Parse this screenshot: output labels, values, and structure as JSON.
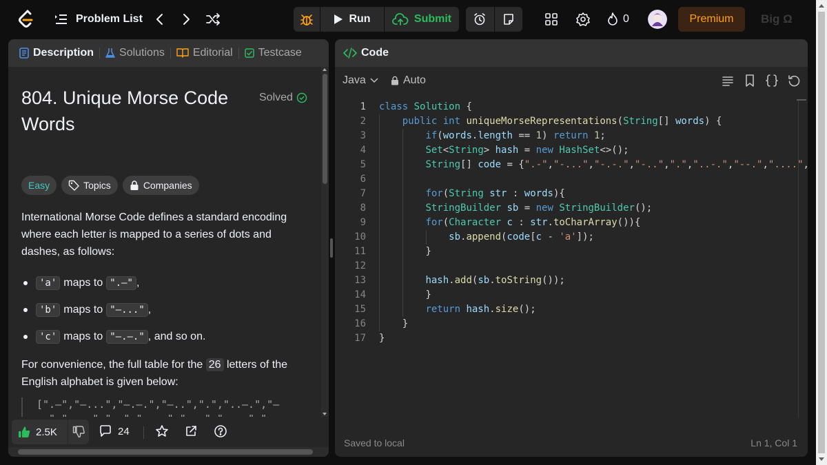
{
  "topbar": {
    "problem_list_label": "Problem List",
    "run_label": "Run",
    "submit_label": "Submit",
    "streak_count": "0",
    "premium_label": "Premium",
    "big_o_label": "Big Ω"
  },
  "left_panel": {
    "tabs": [
      {
        "label": "Description",
        "icon": "description-icon"
      },
      {
        "label": "Solutions",
        "icon": "flask-icon"
      },
      {
        "label": "Editorial",
        "icon": "book-icon"
      },
      {
        "label": "Testcase",
        "icon": "checkbox-icon"
      }
    ],
    "problem_title": "804. Unique Morse Code Words",
    "solved_label": "Solved",
    "tags": {
      "difficulty": "Easy",
      "topics": "Topics",
      "companies": "Companies"
    },
    "paragraph1": "International Morse Code defines a standard encoding where each letter is mapped to a series of dots and dashes, as follows:",
    "bullets": [
      {
        "letter": "'a'",
        "mid": "maps to",
        "code": "\".–\"",
        "suffix": ","
      },
      {
        "letter": "'b'",
        "mid": "maps to",
        "code": "\"–...\"",
        "suffix": ","
      },
      {
        "letter": "'c'",
        "mid": "maps to",
        "code": "\"–.–.\"",
        "suffix": ", and so on."
      }
    ],
    "paragraph2_pre": "For convenience, the full table for the ",
    "paragraph2_num": "26",
    "paragraph2_post": " letters of the English alphabet is given below:",
    "morse_table": "[\".–\",\"–...\",\"–.–.\",\"–..\",\".\",\"..–.\",\"––.\",\"....\",\"..\",\".–––\",\"–.–\",\".–..\",\"––\",\"–.\",\"–––\",\".––.\",\"––.–",
    "likes": "2.5K",
    "comments": "24"
  },
  "editor": {
    "tab_label": "Code",
    "language": "Java",
    "mode": "Auto",
    "status_saved": "Saved to local",
    "cursor_position": "Ln 1, Col 1",
    "line_numbers": [
      "1",
      "2",
      "3",
      "4",
      "5",
      "6",
      "7",
      "8",
      "9",
      "10",
      "11",
      "12",
      "13",
      "14",
      "15",
      "16",
      "17"
    ],
    "lines": [
      "class Solution {",
      "    public int uniqueMorseRepresentations(String[] words) {",
      "        if(words.length == 1) return 1;",
      "        Set<String> hash = new HashSet<>();",
      "        String[] code = {\".-\",\"-...\",\"-.-.\",\"-..\",\".\",\"..-.\",\"--.\",\"....\",",
      "",
      "        for(String str : words){",
      "        StringBuilder sb = new StringBuilder();",
      "        for(Character c : str.toCharArray()){",
      "            sb.append(code[c - 'a']);",
      "        }",
      "",
      "        hash.add(sb.toString());",
      "        }",
      "        return hash.size();",
      "    }",
      "}"
    ]
  }
}
